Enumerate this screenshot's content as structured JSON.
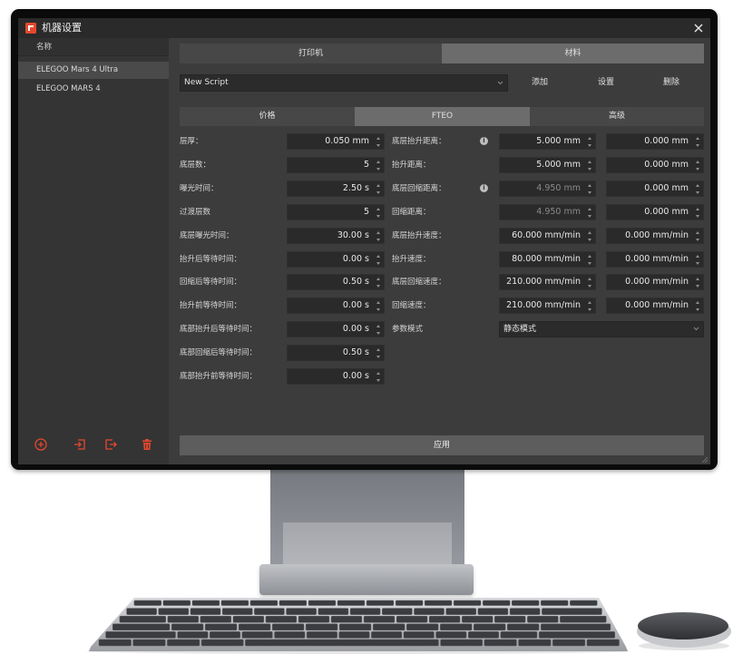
{
  "window": {
    "title": "机器设置",
    "icon": "app-logo-icon",
    "close_icon": "close-icon"
  },
  "sidebar": {
    "header": "名称",
    "items": [
      {
        "label": "ELEGOO Mars 4 Ultra",
        "selected": true
      },
      {
        "label": "ELEGOO MARS 4",
        "selected": false
      }
    ],
    "actions": [
      {
        "icon": "add-circle-icon"
      },
      {
        "icon": "import-icon"
      },
      {
        "icon": "export-icon"
      },
      {
        "icon": "delete-icon"
      }
    ]
  },
  "main_tabs": [
    {
      "label": "打印机",
      "active": false
    },
    {
      "label": "材料",
      "active": true
    }
  ],
  "script_bar": {
    "selected": "New Script",
    "add": "添加",
    "settings": "设置",
    "delete": "删除"
  },
  "sub_tabs": [
    {
      "label": "价格",
      "active": false
    },
    {
      "label": "FTEO",
      "active": true
    },
    {
      "label": "高级",
      "active": false
    }
  ],
  "left_fields": [
    {
      "label": "层厚：",
      "value": "0.050 mm"
    },
    {
      "label": "底层数：",
      "value": "5"
    },
    {
      "label": "曝光时间：",
      "value": "2.50 s"
    },
    {
      "label": "过渡层数",
      "value": "5"
    },
    {
      "label": "底层曝光时间：",
      "value": "30.00 s"
    },
    {
      "label": "抬升后等待时间：",
      "value": "0.00 s"
    },
    {
      "label": "回缩后等待时间：",
      "value": "0.50 s"
    },
    {
      "label": "抬升前等待时间：",
      "value": "0.00 s"
    },
    {
      "label": "底部抬升后等待时间：",
      "value": "0.00 s"
    },
    {
      "label": "底部回缩后等待时间：",
      "value": "0.50 s"
    },
    {
      "label": "底部抬升前等待时间：",
      "value": "0.00 s"
    }
  ],
  "right_fields": [
    {
      "label": "底层抬升距离：",
      "info": true,
      "value": "5.000 mm",
      "value2": "0.000 mm",
      "disabled": false
    },
    {
      "label": "抬升距离：",
      "info": false,
      "value": "5.000 mm",
      "value2": "0.000 mm",
      "disabled": false
    },
    {
      "label": "底层回缩距离：",
      "info": true,
      "value": "4.950 mm",
      "value2": "0.000 mm",
      "disabled": true
    },
    {
      "label": "回缩距离：",
      "info": false,
      "value": "4.950 mm",
      "value2": "0.000 mm",
      "disabled": true
    },
    {
      "label": "底层抬升速度：",
      "info": false,
      "value": "60.000 mm/min",
      "value2": "0.000 mm/min",
      "disabled": false
    },
    {
      "label": "抬升速度：",
      "info": false,
      "value": "80.000 mm/min",
      "value2": "0.000 mm/min",
      "disabled": false
    },
    {
      "label": "底层回缩速度：",
      "info": false,
      "value": "210.000 mm/min",
      "value2": "0.000 mm/min",
      "disabled": false
    },
    {
      "label": "回缩速度：",
      "info": false,
      "value": "210.000 mm/min",
      "value2": "0.000 mm/min",
      "disabled": false
    }
  ],
  "param_mode": {
    "label": "参数模式",
    "value": "静态模式"
  },
  "apply_label": "应用",
  "colors": {
    "accent": "#e5482f",
    "panel": "#3c3c3c",
    "sidebar": "#343434",
    "tab": "#474747",
    "tab_active": "#6c6c6c",
    "input": "#2a2a2a",
    "button": "#5d5d5d"
  }
}
